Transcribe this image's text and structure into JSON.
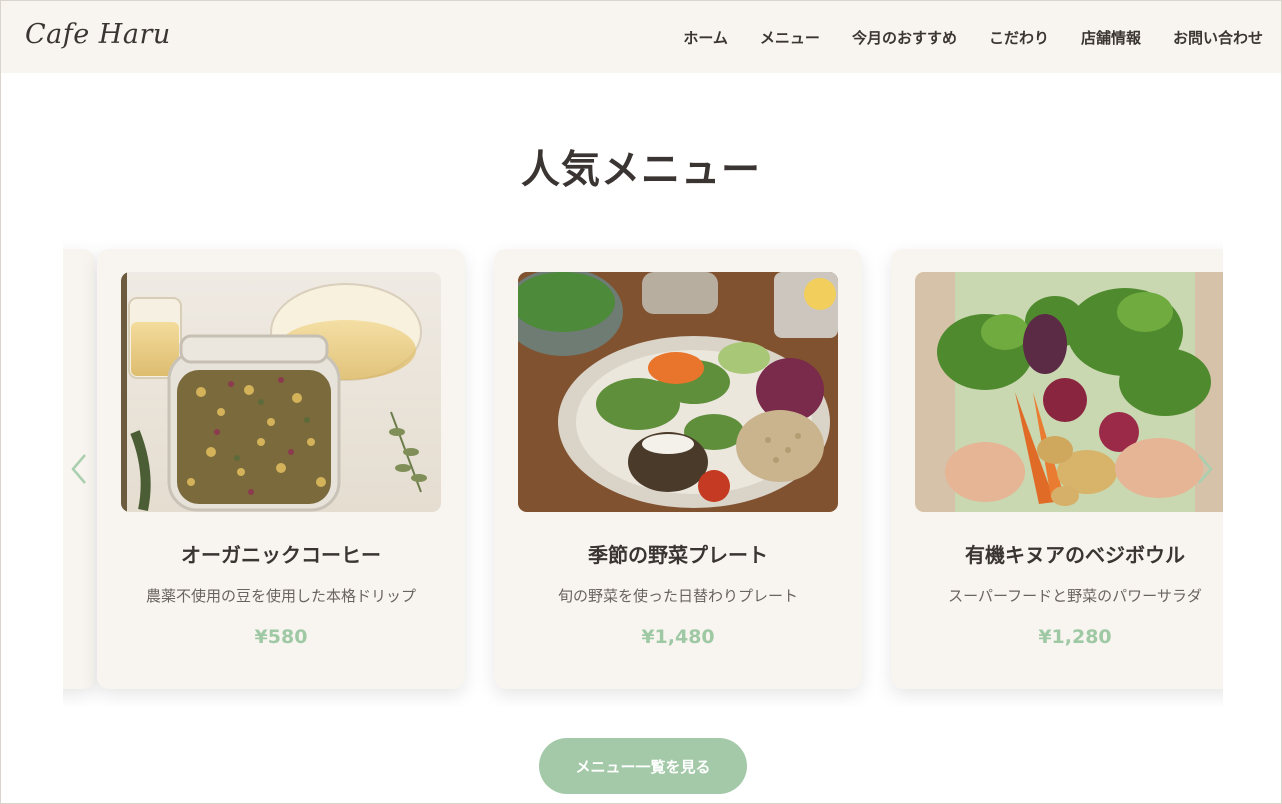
{
  "header": {
    "logo": "Cafe Haru",
    "nav": [
      "ホーム",
      "メニュー",
      "今月のおすすめ",
      "こだわり",
      "店舗情報",
      "お問い合わせ"
    ]
  },
  "section": {
    "title": "人気メニュー"
  },
  "carousel": {
    "cards": [
      {
        "name": "オーガニックコーヒー",
        "desc": "農薬不使用の豆を使用した本格ドリップ",
        "price": "¥580",
        "image": "tea-jar"
      },
      {
        "name": "季節の野菜プレート",
        "desc": "旬の野菜を使った日替わりプレート",
        "price": "¥1,480",
        "image": "vegetable-plate"
      },
      {
        "name": "有機キヌアのベジボウル",
        "desc": "スーパーフードと野菜のパワーサラダ",
        "price": "¥1,280",
        "image": "vegetable-bundle"
      }
    ]
  },
  "cta": {
    "label": "メニュー一覧を見る"
  },
  "colors": {
    "accent": "#a3c9a8",
    "price": "#9fc9a4",
    "header_bg": "#f8f5f0",
    "card_bg": "#f8f5f0",
    "text": "#3a3532"
  },
  "icons": {
    "prev": "chevron-left-icon",
    "next": "chevron-right-icon"
  }
}
